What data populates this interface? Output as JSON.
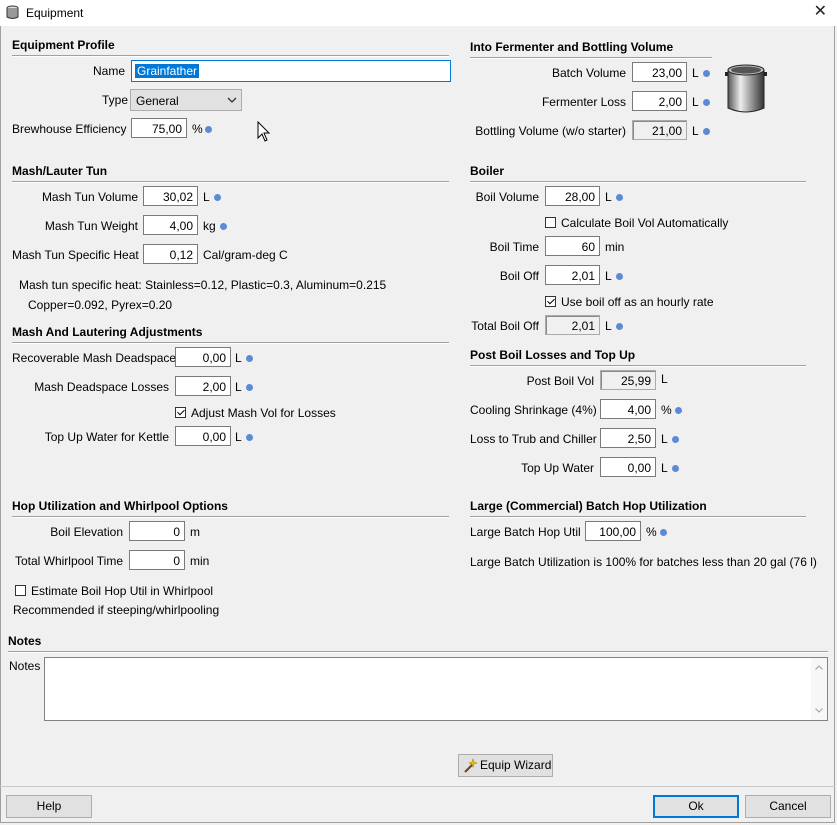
{
  "window": {
    "title": "Equipment"
  },
  "profile": {
    "heading": "Equipment Profile",
    "name_label": "Name",
    "name_value": "Grainfather",
    "type_label": "Type",
    "type_value": "General",
    "efficiency_label": "Brewhouse Efficiency",
    "efficiency_value": "75,00",
    "efficiency_unit": "%"
  },
  "fermenter": {
    "heading": "Into Fermenter and Bottling Volume",
    "batch_label": "Batch Volume",
    "batch_value": "23,00",
    "batch_unit": "L",
    "loss_label": "Fermenter Loss",
    "loss_value": "2,00",
    "loss_unit": "L",
    "bottling_label": "Bottling Volume (w/o starter)",
    "bottling_value": "21,00",
    "bottling_unit": "L"
  },
  "mash": {
    "heading": "Mash/Lauter Tun",
    "volume_label": "Mash Tun Volume",
    "volume_value": "30,02",
    "volume_unit": "L",
    "weight_label": "Mash Tun Weight",
    "weight_value": "4,00",
    "weight_unit": "kg",
    "heat_label": "Mash Tun Specific Heat",
    "heat_value": "0,12",
    "heat_unit": "Cal/gram-deg C",
    "note_line1": "Mash tun specific heat: Stainless=0.12, Plastic=0.3, Aluminum=0.215",
    "note_line2": "Copper=0.092, Pyrex=0.20"
  },
  "boiler": {
    "heading": "Boiler",
    "boil_volume_label": "Boil Volume",
    "boil_volume_value": "28,00",
    "boil_volume_unit": "L",
    "calc_label": "Calculate Boil Vol Automatically",
    "boil_time_label": "Boil Time",
    "boil_time_value": "60",
    "boil_time_unit": "min",
    "boil_off_label": "Boil Off",
    "boil_off_value": "2,01",
    "boil_off_unit": "L",
    "hourly_label": "Use boil off as an hourly rate",
    "total_label": "Total Boil Off",
    "total_value": "2,01",
    "total_unit": "L"
  },
  "adjust": {
    "heading": "Mash And Lautering Adjustments",
    "deadspace_label": "Recoverable Mash Deadspace",
    "deadspace_value": "0,00",
    "deadspace_unit": "L",
    "losses_label": "Mash Deadspace Losses",
    "losses_value": "2,00",
    "losses_unit": "L",
    "adjust_label": "Adjust Mash Vol for Losses",
    "topup_label": "Top Up Water for Kettle",
    "topup_value": "0,00",
    "topup_unit": "L"
  },
  "postboil": {
    "heading": "Post Boil Losses and Top Up",
    "post_label": "Post Boil Vol",
    "post_value": "25,99",
    "post_unit": "L",
    "cool_label": "Cooling Shrinkage (4%)",
    "cool_value": "4,00",
    "cool_unit": "%",
    "trub_label": "Loss to Trub and Chiller",
    "trub_value": "2,50",
    "trub_unit": "L",
    "topup_label": "Top Up Water",
    "topup_value": "0,00",
    "topup_unit": "L"
  },
  "hop": {
    "heading": "Hop Utilization and Whirlpool Options",
    "elev_label": "Boil Elevation",
    "elev_value": "0",
    "elev_unit": "m",
    "whirl_label": "Total Whirlpool Time",
    "whirl_value": "0",
    "whirl_unit": "min",
    "estimate_label": "Estimate Boil Hop Util in Whirlpool",
    "recommend": "Recommended if steeping/whirlpooling"
  },
  "large": {
    "heading": "Large (Commercial) Batch Hop Utilization",
    "util_label": "Large Batch Hop Util",
    "util_value": "100,00",
    "util_unit": "%",
    "note": "Large Batch Utilization is 100% for batches less than 20 gal (76 l)"
  },
  "notes": {
    "heading": "Notes",
    "label": "Notes",
    "value": ""
  },
  "buttons": {
    "wizard": "Equip Wizard",
    "help": "Help",
    "ok": "Ok",
    "cancel": "Cancel"
  },
  "colors": {
    "info_dot": "#5b8ad6",
    "selection": "#0078d7",
    "default_button_border": "#0078d7"
  }
}
